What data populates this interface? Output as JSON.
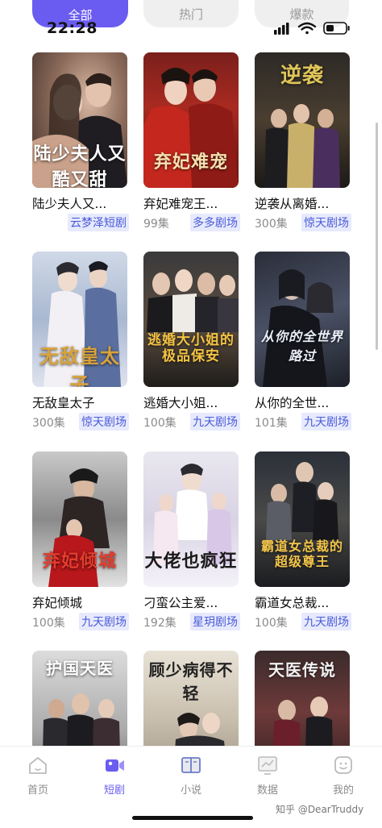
{
  "status": {
    "time": "22:28"
  },
  "tabs": [
    {
      "label": "全部",
      "active": true
    },
    {
      "label": "热门",
      "active": false
    },
    {
      "label": "爆款",
      "active": false
    }
  ],
  "dramas": [
    {
      "title": "陆少夫人又...",
      "episodes": "",
      "platform": "云梦泽短剧",
      "poster_text": "陆少夫人又酷又甜"
    },
    {
      "title": "弃妃难宠王...",
      "episodes": "99集",
      "platform": "多多剧场",
      "poster_text": "弃妃难宠"
    },
    {
      "title": "逆袭从离婚...",
      "episodes": "300集",
      "platform": "惊天剧场",
      "poster_text": "逆袭"
    },
    {
      "title": "无敌皇太子",
      "episodes": "300集",
      "platform": "惊天剧场",
      "poster_text": "无敌皇太子"
    },
    {
      "title": "逃婚大小姐...",
      "episodes": "100集",
      "platform": "九天剧场",
      "poster_text": "逃婚大小姐的极品保安"
    },
    {
      "title": "从你的全世...",
      "episodes": "101集",
      "platform": "九天剧场",
      "poster_text": "从你的全世界路过"
    },
    {
      "title": "弃妃倾城",
      "episodes": "100集",
      "platform": "九天剧场",
      "poster_text": "弃妃倾城"
    },
    {
      "title": "刁蛮公主爱...",
      "episodes": "192集",
      "platform": "星玥剧场",
      "poster_text": "大佬也疯狂"
    },
    {
      "title": "霸道女总裁...",
      "episodes": "100集",
      "platform": "九天剧场",
      "poster_text": "霸道女总裁的超级尊王"
    },
    {
      "title": "",
      "episodes": "",
      "platform": "",
      "poster_text": "护国天医"
    },
    {
      "title": "",
      "episodes": "",
      "platform": "",
      "poster_text": "顾少病得不轻"
    },
    {
      "title": "",
      "episodes": "",
      "platform": "",
      "poster_text": "天医传说"
    }
  ],
  "nav": [
    {
      "label": "首页",
      "icon": "home-icon",
      "active": false
    },
    {
      "label": "短剧",
      "icon": "video-icon",
      "active": true
    },
    {
      "label": "小说",
      "icon": "book-icon",
      "active": false
    },
    {
      "label": "数据",
      "icon": "chart-icon",
      "active": false
    },
    {
      "label": "我的",
      "icon": "profile-icon",
      "active": false
    }
  ],
  "watermark": "知乎 @DearTruddy",
  "colors": {
    "accent": "#6a5cf0",
    "badge_bg": "#e7eafd",
    "badge_text": "#4a5bd6"
  }
}
